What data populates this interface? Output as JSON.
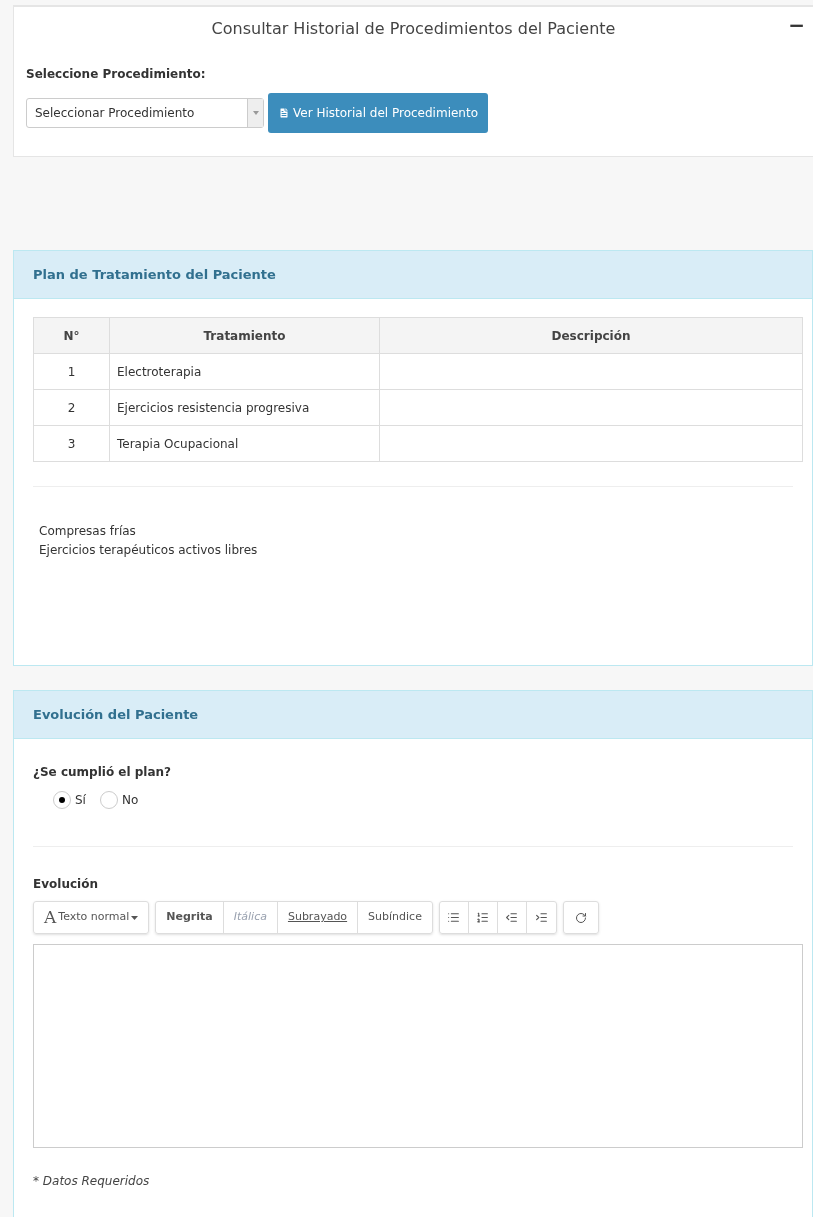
{
  "procedure_panel": {
    "title": "Consultar Historial de Procedimientos del Paciente",
    "collapse_symbol": "−",
    "field_label": "Seleccione Procedimiento:",
    "select": {
      "value": "Seleccionar Procedimiento"
    },
    "button": "Ver Historial del Procedimiento"
  },
  "plan_panel": {
    "title": "Plan de Tratamiento del Paciente",
    "table": {
      "columns": [
        "N°",
        "Tratamiento",
        "Descripción"
      ],
      "rows": [
        [
          "1",
          "Electroterapia",
          ""
        ],
        [
          "2",
          "Ejercicios resistencia progresiva",
          ""
        ],
        [
          "3",
          "Terapia Ocupacional",
          ""
        ]
      ]
    },
    "notes": [
      "Compresas frías",
      "Ejercicios terapéuticos activos libres"
    ]
  },
  "evolution_panel": {
    "title": "Evolución del Paciente",
    "question": "¿Se cumplió el plan?",
    "options": [
      {
        "label": "Sí",
        "selected": true
      },
      {
        "label": "No",
        "selected": false
      }
    ],
    "editor_label": "Evolución",
    "style_dropdown": {
      "glyph": "A",
      "label": "Texto normal"
    },
    "format_buttons": [
      {
        "label": "Negrita",
        "kind": "bold"
      },
      {
        "label": "Itálica",
        "kind": "italic"
      },
      {
        "label": "Subrayado",
        "kind": "underline"
      },
      {
        "label": "Subíndice",
        "kind": "plain"
      }
    ],
    "list_buttons": [
      {
        "kind": "bullets"
      },
      {
        "kind": "numbers"
      },
      {
        "kind": "outdent"
      },
      {
        "kind": "indent"
      }
    ],
    "footnote": "* Datos Requeridos"
  }
}
